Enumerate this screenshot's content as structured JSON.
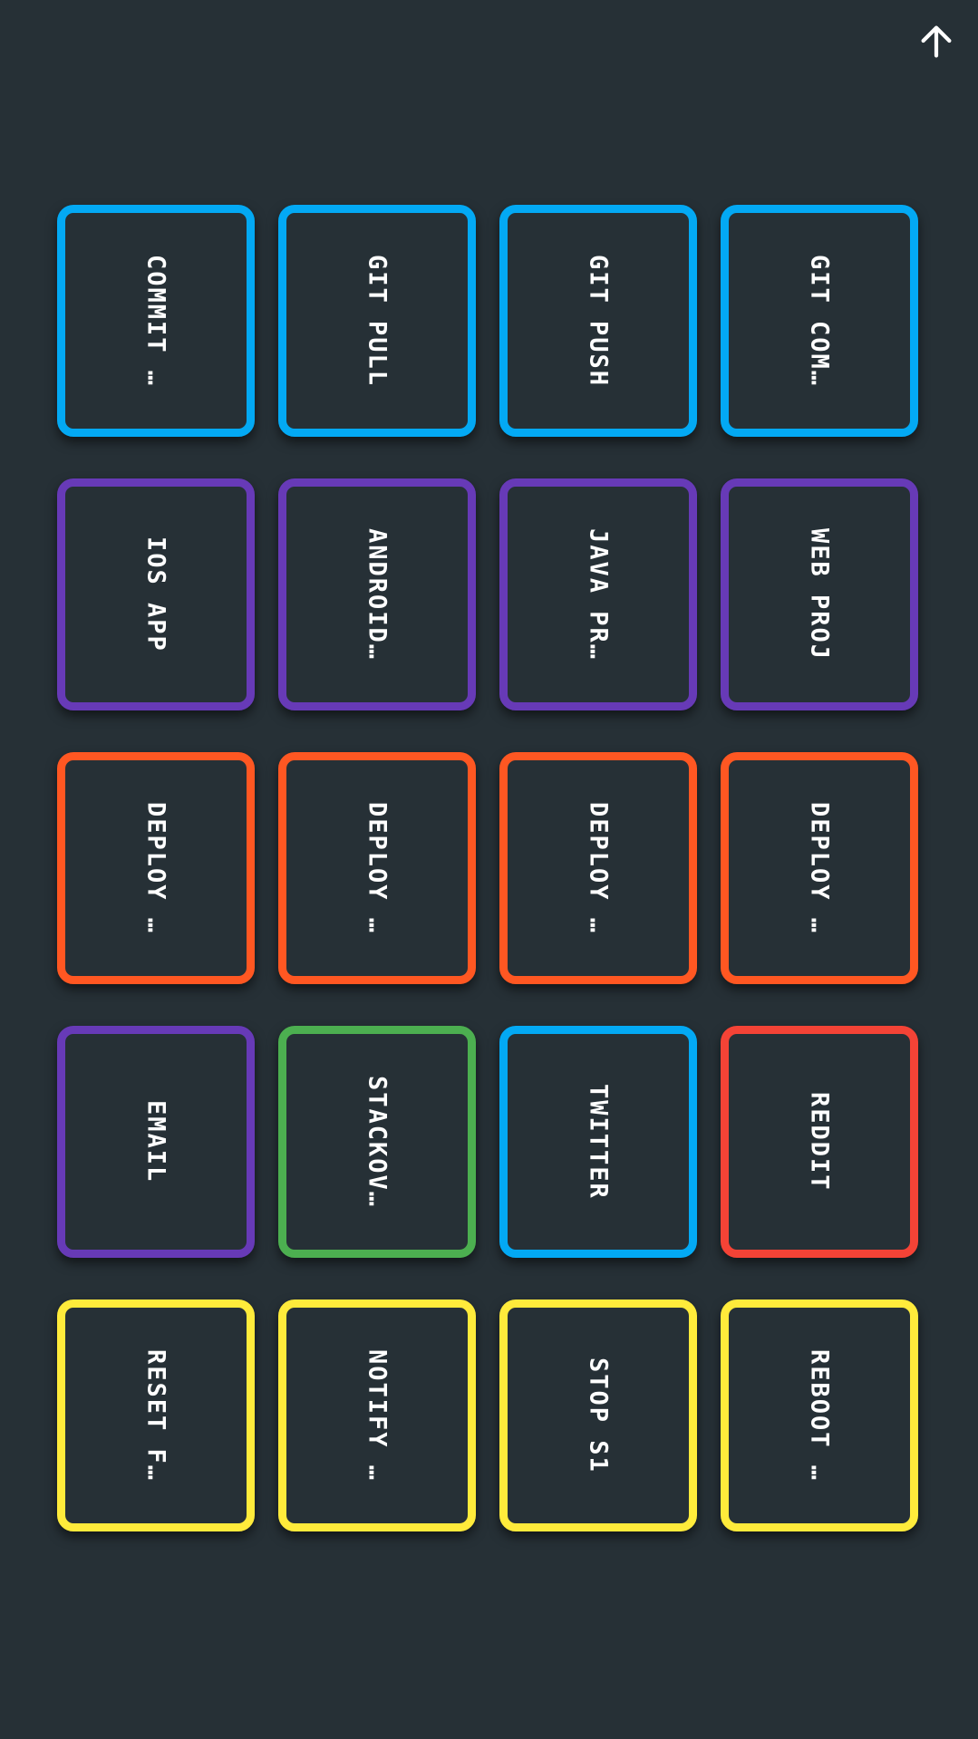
{
  "colors": {
    "background": "#263036",
    "text": "#ffffff",
    "blue": "#03a9f4",
    "purple": "#673ab7",
    "orange": "#ff5722",
    "green": "#4caf50",
    "red": "#f44336",
    "yellow": "#ffeb3b"
  },
  "header": {
    "action_icon": "arrow-up-icon"
  },
  "tiles": [
    {
      "label": "COMMIT …",
      "color": "#03a9f4"
    },
    {
      "label": "GIT PULL",
      "color": "#03a9f4"
    },
    {
      "label": "GIT PUSH",
      "color": "#03a9f4"
    },
    {
      "label": "GIT COM…",
      "color": "#03a9f4"
    },
    {
      "label": "IOS APP",
      "color": "#673ab7"
    },
    {
      "label": "ANDROID…",
      "color": "#673ab7"
    },
    {
      "label": "JAVA PR…",
      "color": "#673ab7"
    },
    {
      "label": "WEB PROJ",
      "color": "#673ab7"
    },
    {
      "label": "DEPLOY …",
      "color": "#ff5722"
    },
    {
      "label": "DEPLOY …",
      "color": "#ff5722"
    },
    {
      "label": "DEPLOY …",
      "color": "#ff5722"
    },
    {
      "label": "DEPLOY …",
      "color": "#ff5722"
    },
    {
      "label": "EMAIL",
      "color": "#673ab7"
    },
    {
      "label": "STACKOV…",
      "color": "#4caf50"
    },
    {
      "label": "TWITTER",
      "color": "#03a9f4"
    },
    {
      "label": "REDDIT",
      "color": "#f44336"
    },
    {
      "label": "RESET F…",
      "color": "#ffeb3b"
    },
    {
      "label": "NOTIFY …",
      "color": "#ffeb3b"
    },
    {
      "label": "STOP S1",
      "color": "#ffeb3b"
    },
    {
      "label": "REBOOT …",
      "color": "#ffeb3b"
    }
  ]
}
